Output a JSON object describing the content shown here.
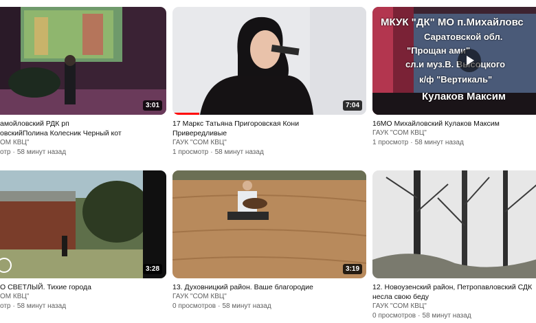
{
  "videos": [
    {
      "title_line1": "амойловский РДК рп",
      "title_line2": "овскийПолина Колесник Черный кот",
      "channel": "ОМ КВЦ\"",
      "views": "отр",
      "age": "58 минут назад",
      "duration": "3:01"
    },
    {
      "title_line1": "17 Маркс Татьяна Пригоровская Кони",
      "title_line2": "Привередливые",
      "channel": "ГАУК \"СОМ КВЦ\"",
      "views": "1 просмотр",
      "age": "58 минут назад",
      "duration": "7:04",
      "progress": 0.14
    },
    {
      "title_line1": "16МО Михайловский Кулаков Максим",
      "channel": "ГАУК \"СОМ КВЦ\"",
      "views": "1 просмотр",
      "age": "58 минут назад",
      "stage_lines": [
        "МКУК \"ДК\" МО п.Михайловс",
        "Саратовской обл.",
        "\"Прощан   ами\"",
        "сл.и муз.В. Высоцкого",
        "к/ф \"Вертикаль\"",
        "Кулаков Максим"
      ]
    },
    {
      "title_line1": "О СВЕТЛЫЙ. Тихие города",
      "channel": "ОМ КВЦ\"",
      "views": "отр",
      "age": "58 минут назад",
      "duration": "3:28"
    },
    {
      "title_line1": "13. Духовницкий район. Ваше благородие",
      "channel": "ГАУК \"СОМ КВЦ\"",
      "views": "0 просмотров",
      "age": "58 минут назад",
      "duration": "3:19"
    },
    {
      "title_line1": "12. Новоузенский район, Петропавловский СДК",
      "title_line2": "несла свою беду",
      "channel": "ГАУК \"СОМ КВЦ\"",
      "views": "0 просмотров",
      "age": "58 минут назад"
    }
  ],
  "colors": {
    "progress": "#ff0000",
    "meta_text": "#606060"
  }
}
